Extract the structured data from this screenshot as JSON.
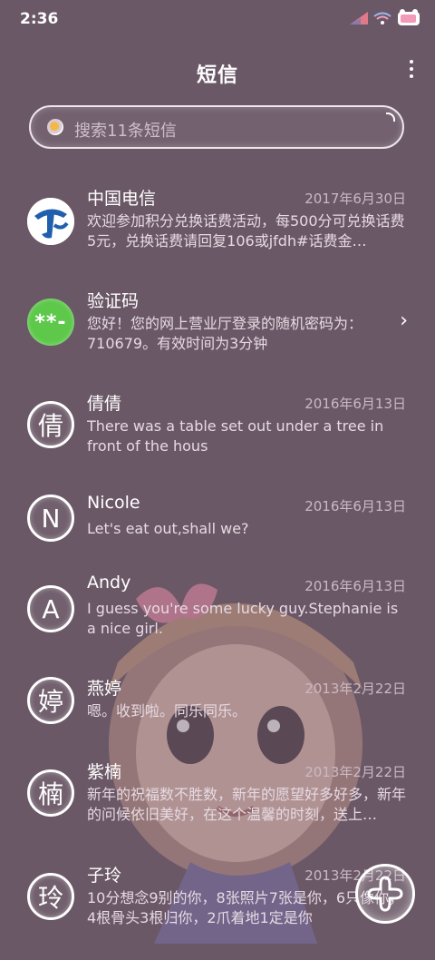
{
  "status": {
    "time": "2:36"
  },
  "header": {
    "title": "短信"
  },
  "search": {
    "placeholder": "搜索11条短信"
  },
  "conversations": [
    {
      "name": "中国电信",
      "date": "2017年6月30日",
      "preview": "欢迎参加积分兑换话费活动，每500分可兑换话费5元，兑换话费请回复106或jfdh#话费金…",
      "avatar": ""
    },
    {
      "name": "验证码",
      "date": "",
      "preview": "您好！您的网上营业厅登录的随机密码为：710679。有效时间为3分钟",
      "avatar": "**-"
    },
    {
      "name": "倩倩",
      "date": "2016年6月13日",
      "preview": "There was a table set out under a tree in front of the hous",
      "avatar": "倩"
    },
    {
      "name": "Nicole",
      "date": "2016年6月13日",
      "preview": "Let's eat out,shall we?",
      "avatar": "N"
    },
    {
      "name": "Andy",
      "date": "2016年6月13日",
      "preview": "I guess you're some lucky guy.Stephanie is a nice girl.",
      "avatar": "A"
    },
    {
      "name": "燕婷",
      "date": "2013年2月22日",
      "preview": "嗯。收到啦。同乐同乐。",
      "avatar": "婷"
    },
    {
      "name": "紫楠",
      "date": "2013年2月22日",
      "preview": "新年的祝福数不胜数，新年的愿望好多好多，新年的问候依旧美好，在这个温馨的时刻，送上…",
      "avatar": "楠"
    },
    {
      "name": "子玲",
      "date": "2013年2月22日",
      "preview": "10分想念9别的你，8张照片7张是你，6只像你，4根骨头3根归你，2爪着地1定是你",
      "avatar": "玲"
    }
  ],
  "icons": {
    "search": "search-icon",
    "menu": "more-vert-icon",
    "compose": "plus-icon",
    "chevron": "chevron-right-icon"
  },
  "colors": {
    "background": "#6b5867",
    "accent": "#5dc84a",
    "telecom": "#1f5fae"
  }
}
